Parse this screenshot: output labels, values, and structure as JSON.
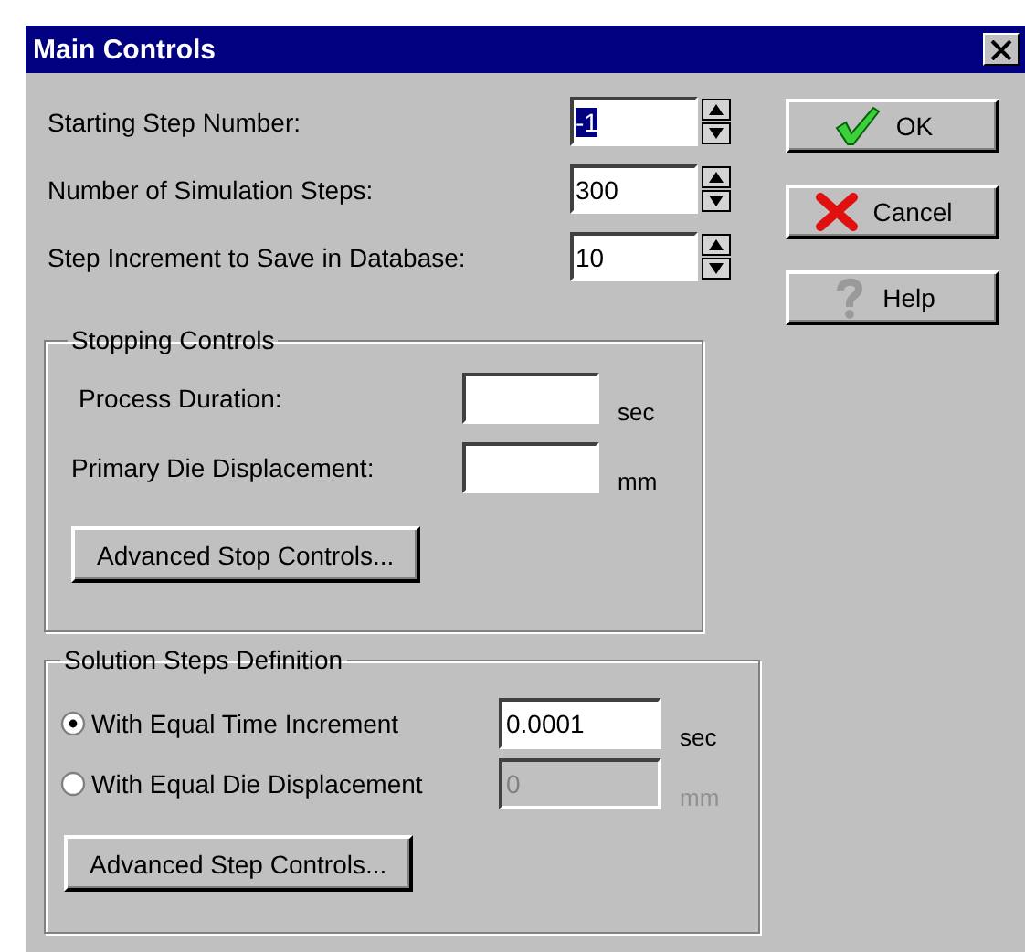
{
  "window": {
    "title": "Main Controls"
  },
  "spin_fields": [
    {
      "label": "Starting Step Number:",
      "value": "-1",
      "text_selected": true
    },
    {
      "label": "Number of Simulation Steps:",
      "value": "300",
      "text_selected": false
    },
    {
      "label": "Step Increment to Save in Database:",
      "value": "10",
      "text_selected": false
    }
  ],
  "buttons": [
    {
      "label": "OK",
      "kind": "ok"
    },
    {
      "label": "Cancel",
      "kind": "cancel"
    },
    {
      "label": "Help",
      "kind": "help"
    }
  ],
  "stopping_controls": {
    "title": "Stopping Controls",
    "fields": [
      {
        "label": "Process Duration:",
        "unit": "sec"
      },
      {
        "label": "Primary Die Displacement:",
        "unit": "mm"
      }
    ],
    "button": "Advanced Stop Controls..."
  },
  "solution_steps": {
    "title": "Solution Steps Definition",
    "options": [
      {
        "label": "With Equal Time Increment",
        "selected": true,
        "value": "0.0001",
        "unit": "sec",
        "disabled": false
      },
      {
        "label": "With Equal Die Displacement",
        "selected": false,
        "value": "0",
        "unit": "mm",
        "disabled": true
      }
    ],
    "button": "Advanced Step Controls..."
  }
}
